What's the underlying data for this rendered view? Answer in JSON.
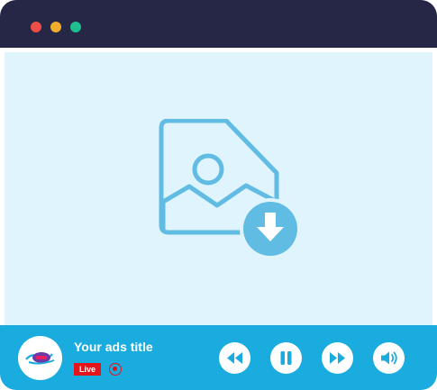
{
  "window": {
    "controls": [
      "close",
      "minimize",
      "maximize"
    ],
    "colors": {
      "titlebar": "#262646",
      "close": "#ee4e45",
      "minimize": "#f3ad2c",
      "maximize": "#1fbf8f"
    }
  },
  "content": {
    "icon": "image-download-icon",
    "background": "#e0f4fd",
    "icon_color": "#61bce4"
  },
  "player": {
    "background": "#1aabdf",
    "logo": "station-logo",
    "title": "Your ads title",
    "live_label": "Live",
    "record_icon": "record-icon",
    "controls": [
      {
        "name": "rewind",
        "icon": "rewind-icon"
      },
      {
        "name": "pause",
        "icon": "pause-icon"
      },
      {
        "name": "fast-forward",
        "icon": "fast-forward-icon"
      },
      {
        "name": "volume",
        "icon": "volume-icon"
      }
    ]
  }
}
